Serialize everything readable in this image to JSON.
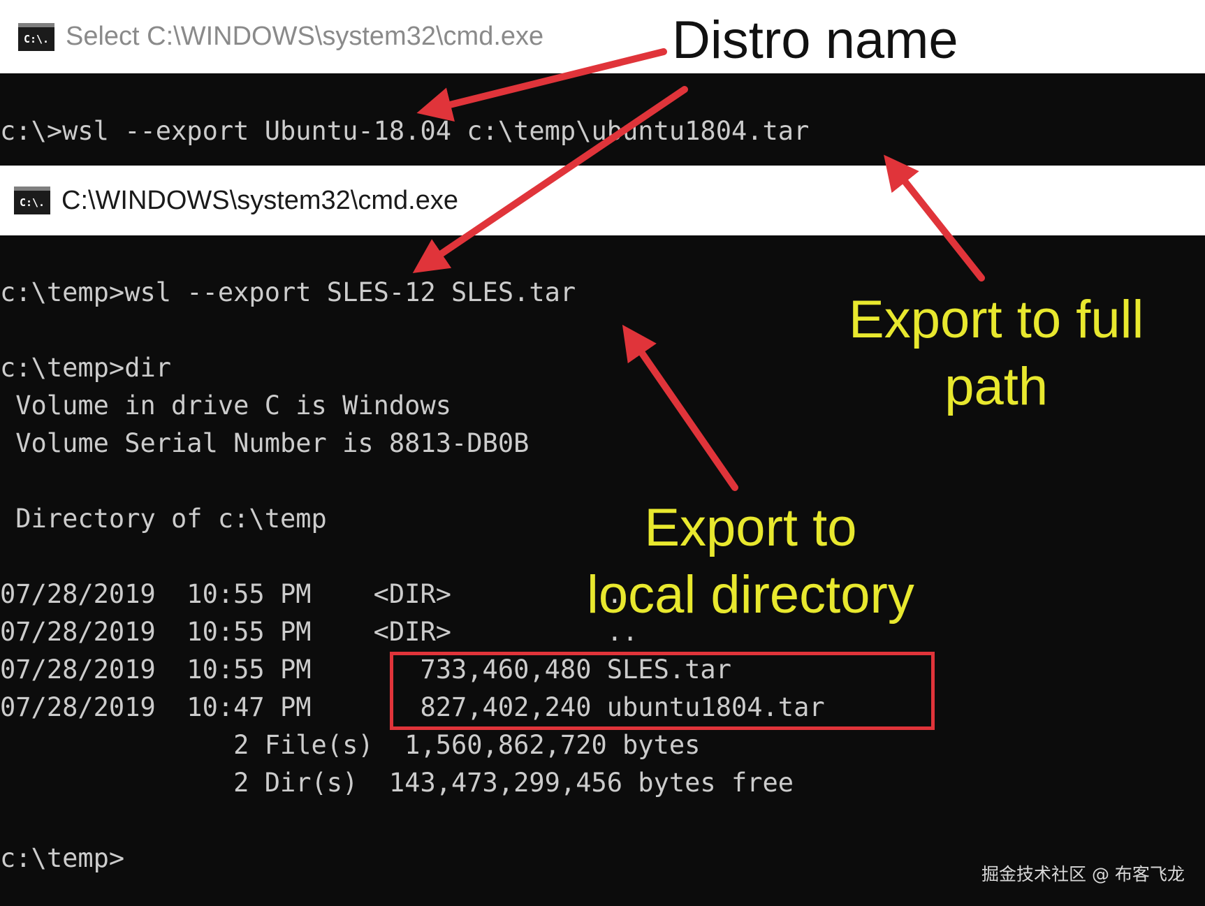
{
  "windows": [
    {
      "title": "Select C:\\WINDOWS\\system32\\cmd.exe",
      "icon": "cmd-console-icon",
      "lines": [
        "c:\\>wsl --export Ubuntu-18.04 c:\\temp\\ubuntu1804.tar"
      ]
    },
    {
      "title": "C:\\WINDOWS\\system32\\cmd.exe",
      "icon": "cmd-console-icon",
      "lines": [
        "c:\\temp>wsl --export SLES-12 SLES.tar",
        "c:\\temp>dir",
        " Volume in drive C is Windows",
        " Volume Serial Number is 8813-DB0B",
        " Directory of c:\\temp",
        "07/28/2019  10:55 PM    <DIR>          .",
        "07/28/2019  10:55 PM    <DIR>          ..",
        "07/28/2019  10:55 PM       733,460,480 SLES.tar",
        "07/28/2019  10:47 PM       827,402,240 ubuntu1804.tar",
        "               2 File(s)  1,560,862,720 bytes",
        "               2 Dir(s)  143,473,299,456 bytes free",
        "c:\\temp>"
      ]
    }
  ],
  "annotations": {
    "distro_name": "Distro name",
    "full_path_line1": "Export to full",
    "full_path_line2": "path",
    "local_dir_line1": "Export to",
    "local_dir_line2": "local directory"
  },
  "colors": {
    "console_bg": "#0c0c0c",
    "console_text": "#cccccc",
    "annotation_yellow": "#e8e82e",
    "arrow_red": "#e0343a"
  },
  "watermark": "掘金技术社区 @ 布客飞龙"
}
